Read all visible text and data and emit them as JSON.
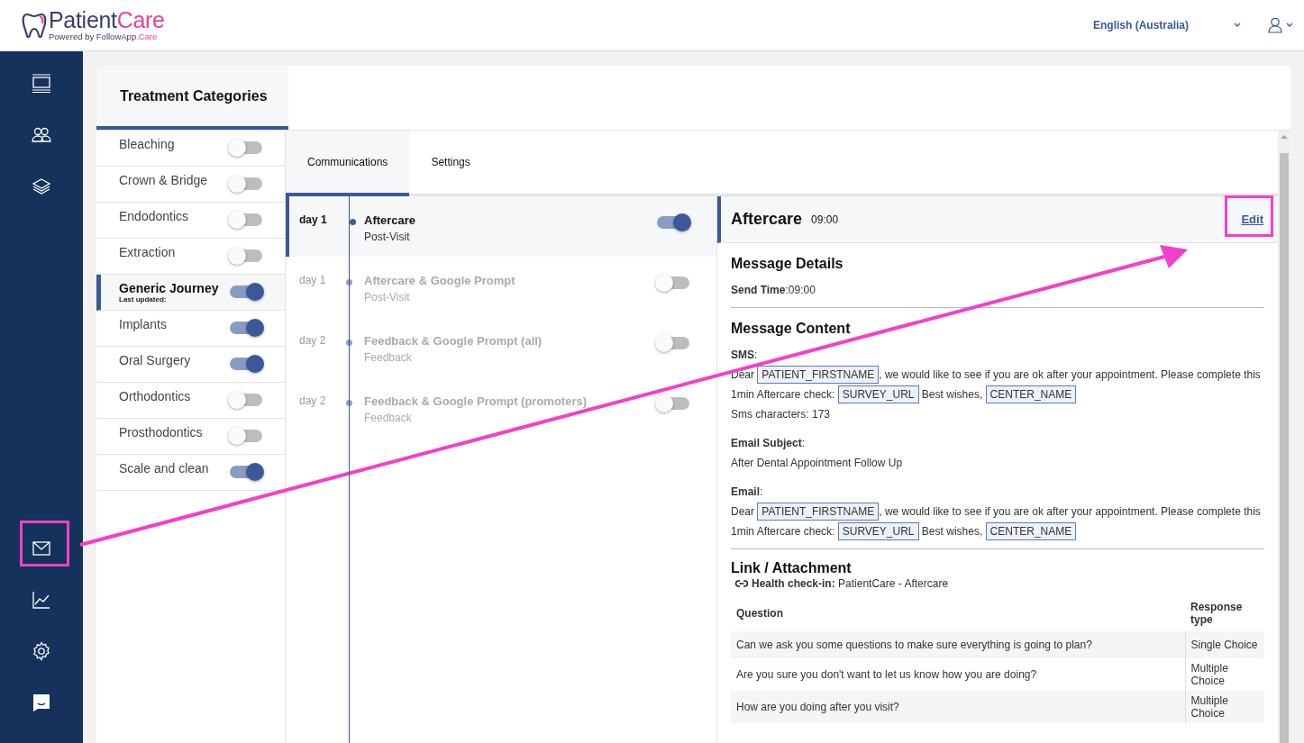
{
  "header": {
    "logo": {
      "title_parts": [
        "Patient",
        "Care"
      ],
      "subtitle_parts": [
        "Powered by FollowApp",
        ".Care"
      ]
    },
    "language": "English (Australia)"
  },
  "categories": {
    "title": "Treatment Categories",
    "items": [
      {
        "name": "Bleaching",
        "selected": false,
        "on": false
      },
      {
        "name": "Crown & Bridge",
        "selected": false,
        "on": false
      },
      {
        "name": "Endodontics",
        "selected": false,
        "on": false
      },
      {
        "name": "Extraction",
        "selected": false,
        "on": false
      },
      {
        "name": "Generic Journey",
        "subtitle": "Last updated:",
        "selected": true,
        "on": true
      },
      {
        "name": "Implants",
        "selected": false,
        "on": true
      },
      {
        "name": "Oral Surgery",
        "selected": false,
        "on": true
      },
      {
        "name": "Orthodontics",
        "selected": false,
        "on": false
      },
      {
        "name": "Prosthodontics",
        "selected": false,
        "on": false
      },
      {
        "name": "Scale and clean",
        "selected": false,
        "on": true
      }
    ]
  },
  "tabs": [
    {
      "label": "Communications",
      "selected": true
    },
    {
      "label": "Settings",
      "selected": false
    }
  ],
  "communications": [
    {
      "day": "day 1",
      "title": "Aftercare",
      "subtitle": "Post-Visit",
      "selected": true,
      "on": true
    },
    {
      "day": "day 1",
      "title": "Aftercare & Google Prompt",
      "subtitle": "Post-Visit",
      "selected": false,
      "on": false
    },
    {
      "day": "day 2",
      "title": "Feedback & Google Prompt (all)",
      "subtitle": "Feedback",
      "selected": false,
      "on": false
    },
    {
      "day": "day 2",
      "title": "Feedback & Google Prompt (promoters)",
      "subtitle": "Feedback",
      "selected": false,
      "on": false
    }
  ],
  "detail": {
    "title": "Aftercare",
    "time": "09:00",
    "edit": "Edit",
    "message_details": {
      "heading": "Message Details",
      "send_time": "**Send Time**:09:00"
    },
    "message_content": {
      "heading": "Message Content",
      "sms_label": "**SMS**:",
      "sms_parts": [
        {
          "kind": "text",
          "text": "Dear "
        },
        {
          "kind": "token",
          "text": "PATIENT_FIRSTNAME"
        },
        {
          "kind": "text",
          "text": ", we would like to see if you are ok after your appointment. Please complete this 1min Aftercare check: "
        },
        {
          "kind": "token",
          "text": "SURVEY_URL"
        },
        {
          "kind": "text",
          "text": " Best wishes, "
        },
        {
          "kind": "token",
          "text": "CENTER_NAME"
        }
      ],
      "sms_characters": "Sms characters: 173",
      "email_subject_label": "**Email Subject**:",
      "email_subject": "After Dental Appointment Follow Up",
      "email_label": "**Email**:",
      "email_parts": [
        {
          "kind": "text",
          "text": "Dear "
        },
        {
          "kind": "token",
          "text": "PATIENT_FIRSTNAME"
        },
        {
          "kind": "text",
          "text": ", we would like to see if you are ok after your appointment. Please complete this 1min Aftercare check: "
        },
        {
          "kind": "token",
          "text": "SURVEY_URL"
        },
        {
          "kind": "text",
          "text": " Best wishes, "
        },
        {
          "kind": "token",
          "text": "CENTER_NAME"
        }
      ]
    },
    "link": {
      "heading": "Link / Attachment",
      "health_check": "**Health check-in:** PatientCare - Aftercare"
    },
    "table": {
      "columns": [
        "Question",
        "Response type"
      ],
      "rows": [
        [
          "Can we ask you some questions to make sure everything is going to plan?",
          "Single Choice"
        ],
        [
          "Are you sure you don't want to let us know how you are doing?",
          "Multiple Choice"
        ],
        [
          "How are you doing after you visit?",
          "Multiple Choice"
        ]
      ]
    }
  }
}
